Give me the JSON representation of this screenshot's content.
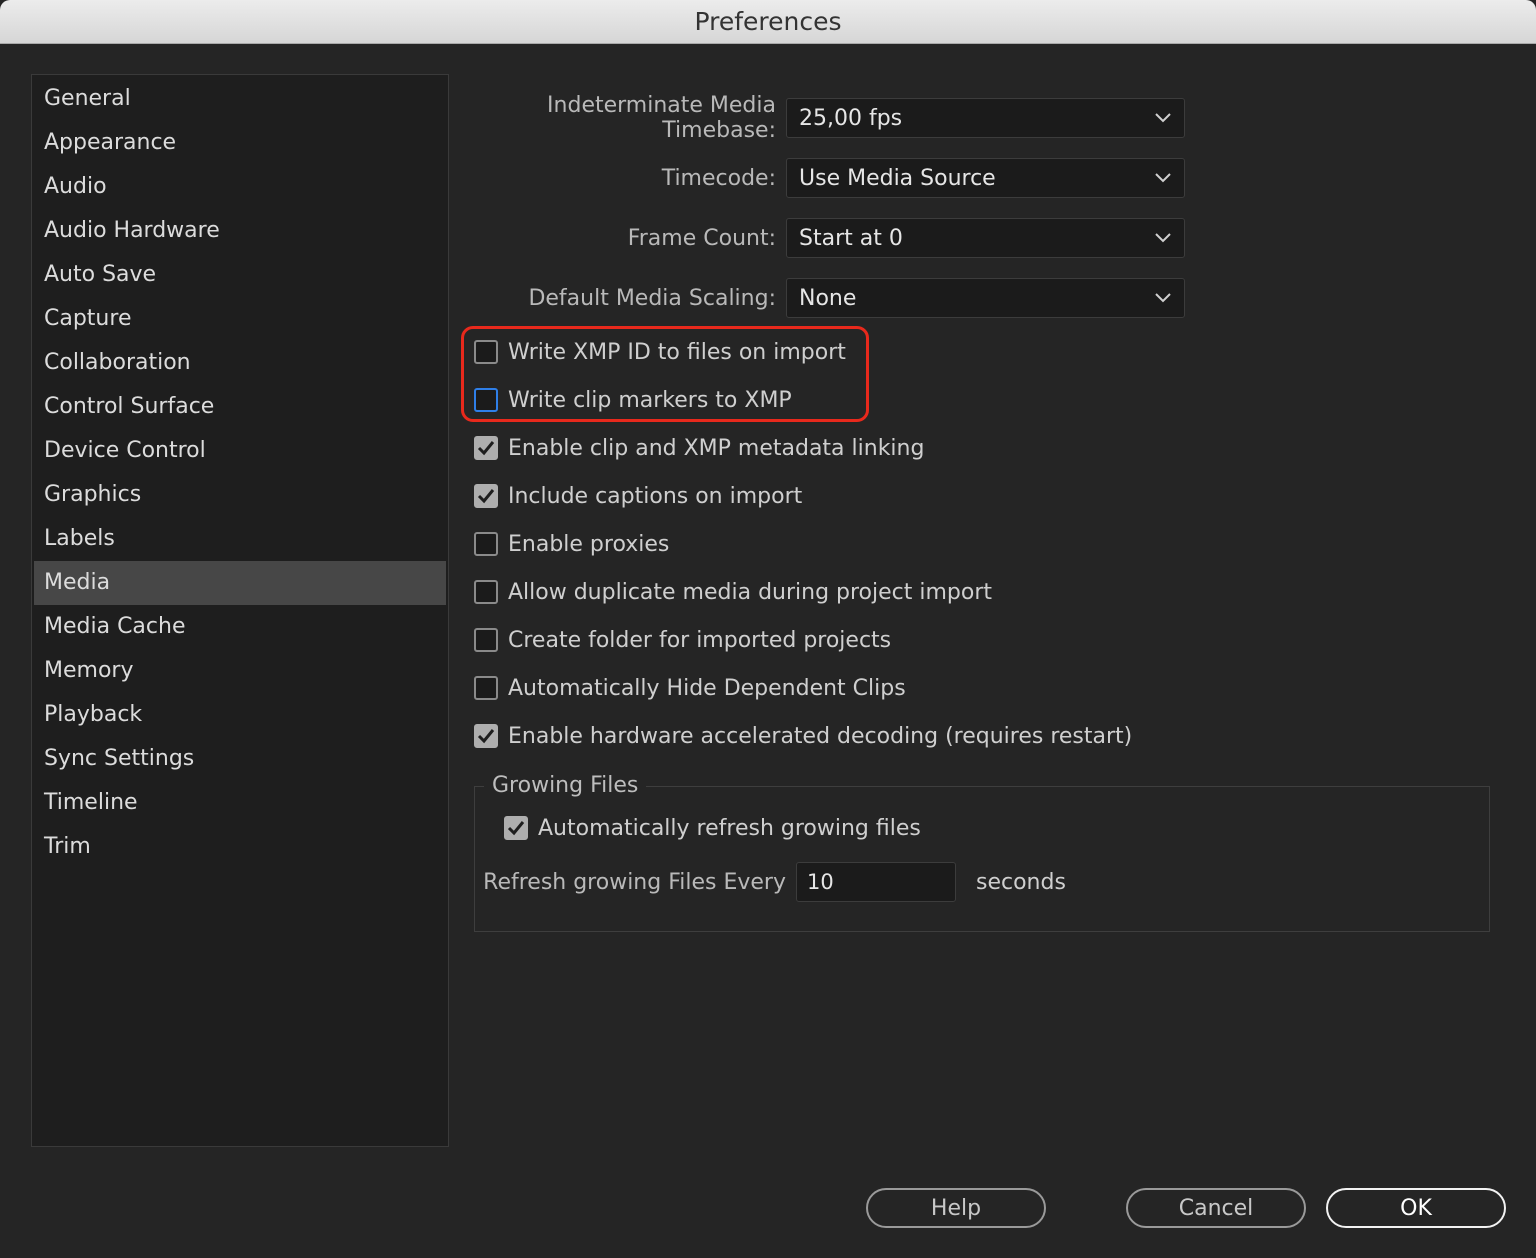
{
  "window": {
    "title": "Preferences"
  },
  "sidebar": {
    "items": [
      {
        "label": "General"
      },
      {
        "label": "Appearance"
      },
      {
        "label": "Audio"
      },
      {
        "label": "Audio Hardware"
      },
      {
        "label": "Auto Save"
      },
      {
        "label": "Capture"
      },
      {
        "label": "Collaboration"
      },
      {
        "label": "Control Surface"
      },
      {
        "label": "Device Control"
      },
      {
        "label": "Graphics"
      },
      {
        "label": "Labels"
      },
      {
        "label": "Media"
      },
      {
        "label": "Media Cache"
      },
      {
        "label": "Memory"
      },
      {
        "label": "Playback"
      },
      {
        "label": "Sync Settings"
      },
      {
        "label": "Timeline"
      },
      {
        "label": "Trim"
      }
    ],
    "selected": "Media"
  },
  "settings": {
    "timebase": {
      "label": "Indeterminate Media Timebase:",
      "value": "25,00 fps"
    },
    "timecode": {
      "label": "Timecode:",
      "value": "Use Media Source"
    },
    "frame_count": {
      "label": "Frame Count:",
      "value": "Start at 0"
    },
    "scaling": {
      "label": "Default Media Scaling:",
      "value": "None"
    }
  },
  "checkboxes": [
    {
      "label": "Write XMP ID to files on import",
      "checked": false
    },
    {
      "label": "Write clip markers to XMP",
      "checked": false,
      "focused": true
    },
    {
      "label": "Enable clip and XMP metadata linking",
      "checked": true
    },
    {
      "label": "Include captions on import",
      "checked": true
    },
    {
      "label": "Enable proxies",
      "checked": false
    },
    {
      "label": "Allow duplicate media during project import",
      "checked": false
    },
    {
      "label": "Create folder for imported projects",
      "checked": false
    },
    {
      "label": "Automatically Hide Dependent Clips",
      "checked": false
    },
    {
      "label": "Enable hardware accelerated decoding (requires restart)",
      "checked": true
    }
  ],
  "growing_files": {
    "title": "Growing Files",
    "auto_refresh": {
      "label": "Automatically refresh growing files",
      "checked": true
    },
    "refresh_label": "Refresh growing Files Every",
    "refresh_value": "10",
    "unit": "seconds"
  },
  "buttons": {
    "help": "Help",
    "cancel": "Cancel",
    "ok": "OK"
  },
  "colors": {
    "highlight": "#e8291c",
    "focus": "#2f7fe8",
    "selected_bg": "#474747"
  }
}
